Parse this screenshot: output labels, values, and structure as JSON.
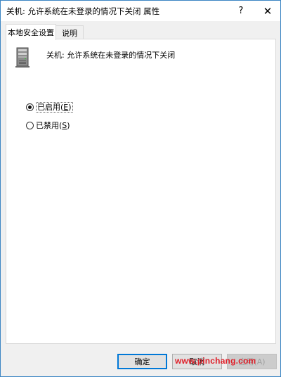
{
  "window": {
    "title": "关机: 允许系统在未登录的情况下关闭 属性",
    "help_glyph": "?",
    "close_glyph": "✕"
  },
  "tabs": [
    {
      "label": "本地安全设置",
      "active": true
    },
    {
      "label": "说明",
      "active": false
    }
  ],
  "policy": {
    "icon": "server-icon",
    "title": "关机: 允许系统在未登录的情况下关闭"
  },
  "options": {
    "enabled": {
      "label": "已启用",
      "accel_open": "(",
      "accel_key": "E",
      "accel_close": ")",
      "checked": true
    },
    "disabled": {
      "label": "已禁用",
      "accel_open": "(",
      "accel_key": "S",
      "accel_close": ")",
      "checked": false
    }
  },
  "buttons": {
    "ok": "确定",
    "cancel": "取消",
    "apply": "应用(A)"
  },
  "watermark": "www.pinchang.com",
  "colors": {
    "accent": "#0078d7",
    "watermark": "#e0202a",
    "window_border": "#3c85c4"
  }
}
